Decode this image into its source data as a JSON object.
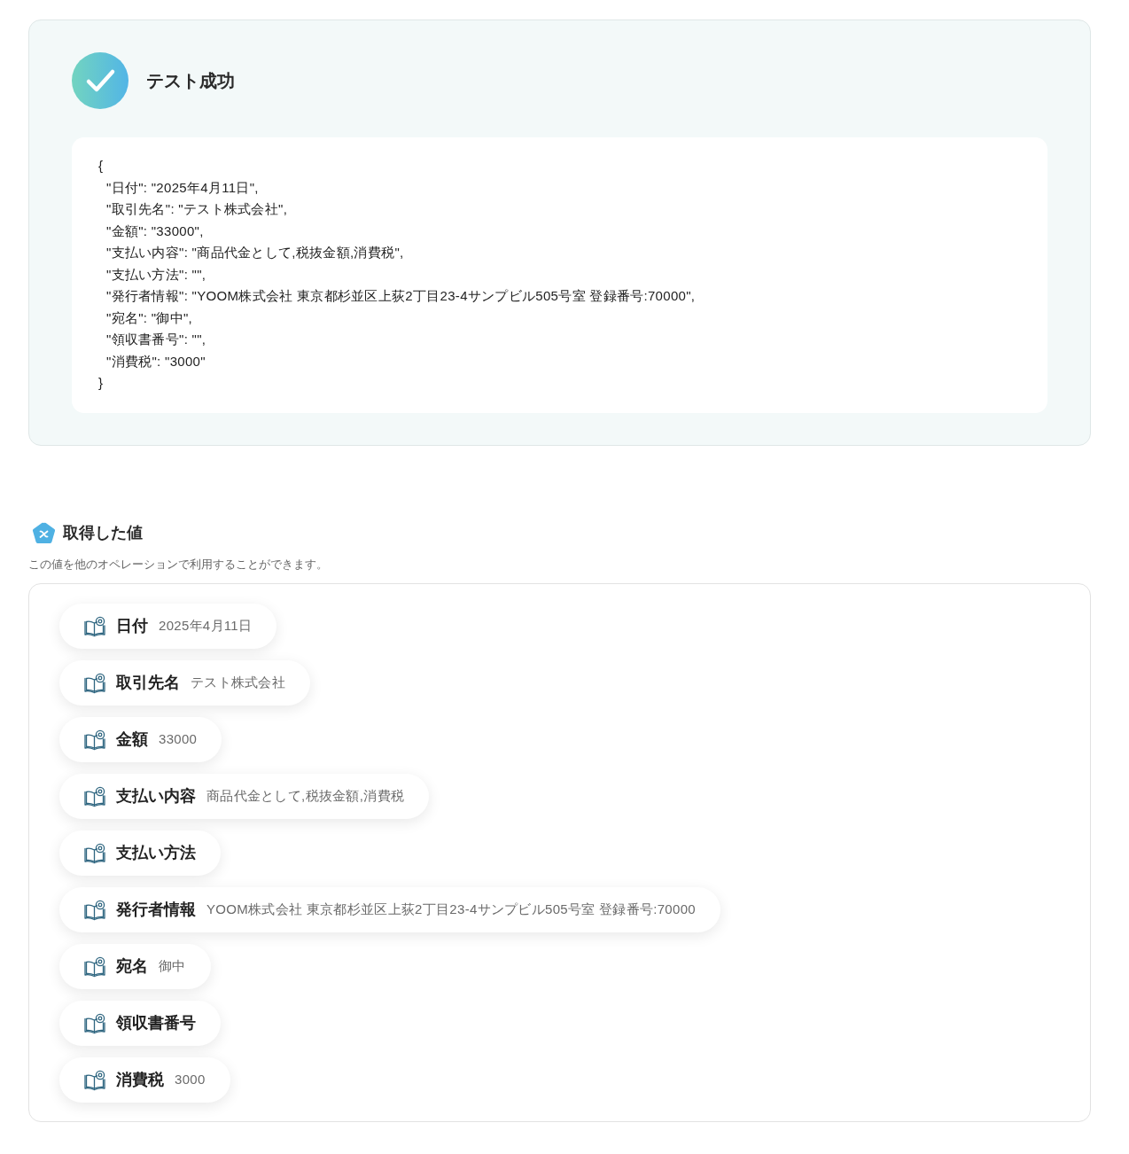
{
  "result": {
    "title": "テスト成功",
    "output": "{\n  \"日付\": \"2025年4月11日\",\n  \"取引先名\": \"テスト株式会社\",\n  \"金額\": \"33000\",\n  \"支払い内容\": \"商品代金として,税抜金額,消費税\",\n  \"支払い方法\": \"\",\n  \"発行者情報\": \"YOOM株式会社 東京都杉並区上荻2丁目23-4サンプビル505号室 登録番号:70000\",\n  \"宛名\": \"御中\",\n  \"領収書番号\": \"\",\n  \"消費税\": \"3000\"\n}"
  },
  "values_section": {
    "title": "取得した値",
    "description": "この値を他のオペレーションで利用することができます。",
    "items": [
      {
        "key": "日付",
        "value": "2025年4月11日"
      },
      {
        "key": "取引先名",
        "value": "テスト株式会社"
      },
      {
        "key": "金額",
        "value": "33000"
      },
      {
        "key": "支払い内容",
        "value": "商品代金として,税抜金額,消費税"
      },
      {
        "key": "支払い方法"
      },
      {
        "key": "発行者情報",
        "value": "YOOM株式会社 東京都杉並区上荻2丁目23-4サンプビル505号室 登録番号:70000"
      },
      {
        "key": "宛名",
        "value": "御中"
      },
      {
        "key": "領収書番号"
      },
      {
        "key": "消費税",
        "value": "3000"
      }
    ]
  }
}
